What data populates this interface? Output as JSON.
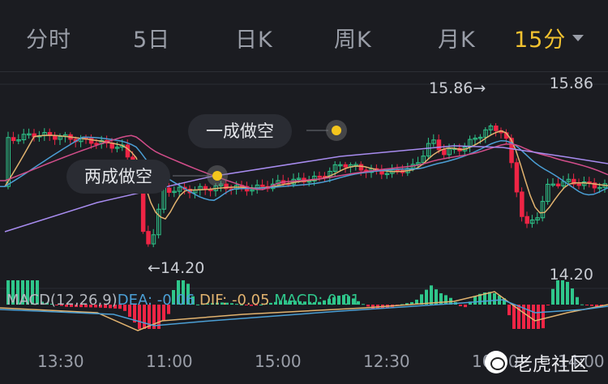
{
  "tabs": [
    {
      "label": "分时",
      "active": false
    },
    {
      "label": "5日",
      "active": false
    },
    {
      "label": "日K",
      "active": false
    },
    {
      "label": "周K",
      "active": false
    },
    {
      "label": "月K",
      "active": false
    },
    {
      "label": "15分",
      "active": true
    }
  ],
  "price_labels": {
    "high_marker": "15.86→",
    "low_marker": "←14.20",
    "axis_max": "15.86",
    "axis_min": "14.20"
  },
  "annotations": {
    "signal_1": "一成做空",
    "signal_2": "两成做空"
  },
  "macd_header": {
    "name": "MACD(12,26,9)",
    "dea": "DEA: -0.06",
    "dif": "DIF: -0.05",
    "macd": "MACD: 0.01"
  },
  "time_axis": [
    "13:30",
    "11:00",
    "15:00",
    "12:30",
    "10:00",
    "14:00"
  ],
  "watermark": "老虎社区",
  "colors": {
    "background": "#1b1c21",
    "up": "#2fc68b",
    "down": "#ee2545",
    "active_tab": "#f2c230",
    "ma_short": "#e2b36f",
    "ma_mid": "#4b9fd5",
    "ma_long": "#d24d8a",
    "ma_longest": "#a88cf0"
  },
  "chart_data": {
    "type": "candlestick",
    "y_range": [
      14.2,
      15.86
    ],
    "high": 15.86,
    "low": 14.2,
    "indicator": "MACD(12,26,9)"
  }
}
